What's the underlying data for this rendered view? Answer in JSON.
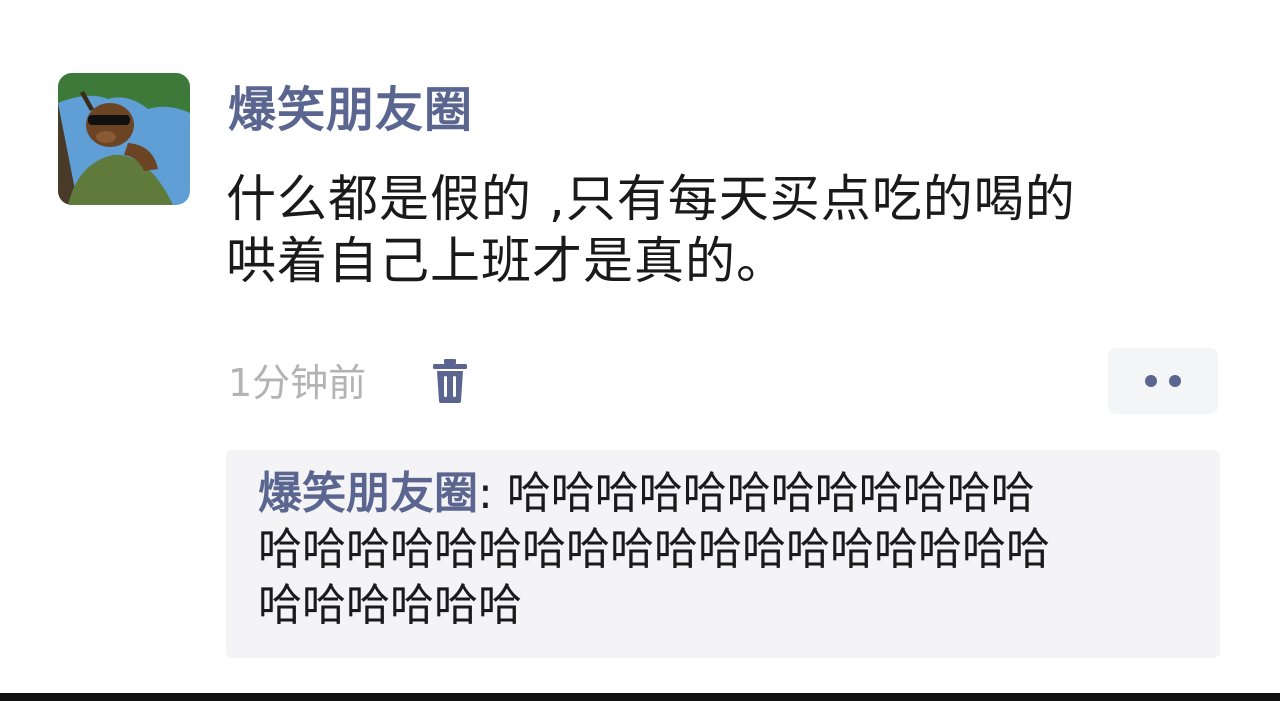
{
  "post": {
    "author": "爆笑朋友圈",
    "text_lines": [
      "什么都是假的 ,只有每天买点吃的喝的",
      "哄着自己上班才是真的。"
    ],
    "timestamp": "1分钟前",
    "delete_icon": "trash-icon",
    "more_icon": "more-dots-icon"
  },
  "comments": [
    {
      "author": "爆笑朋友圈",
      "separator": ": ",
      "first_line": "哈哈哈哈哈哈哈哈哈哈哈哈",
      "continuation_lines": [
        "哈哈哈哈哈哈哈哈哈哈哈哈哈哈哈哈哈哈",
        "哈哈哈哈哈哈"
      ]
    }
  ],
  "colors": {
    "author_name": "#5b6690",
    "body_text": "#1a1a1a",
    "timestamp": "#b3b3b3",
    "comment_bg": "#f4f4f6"
  }
}
